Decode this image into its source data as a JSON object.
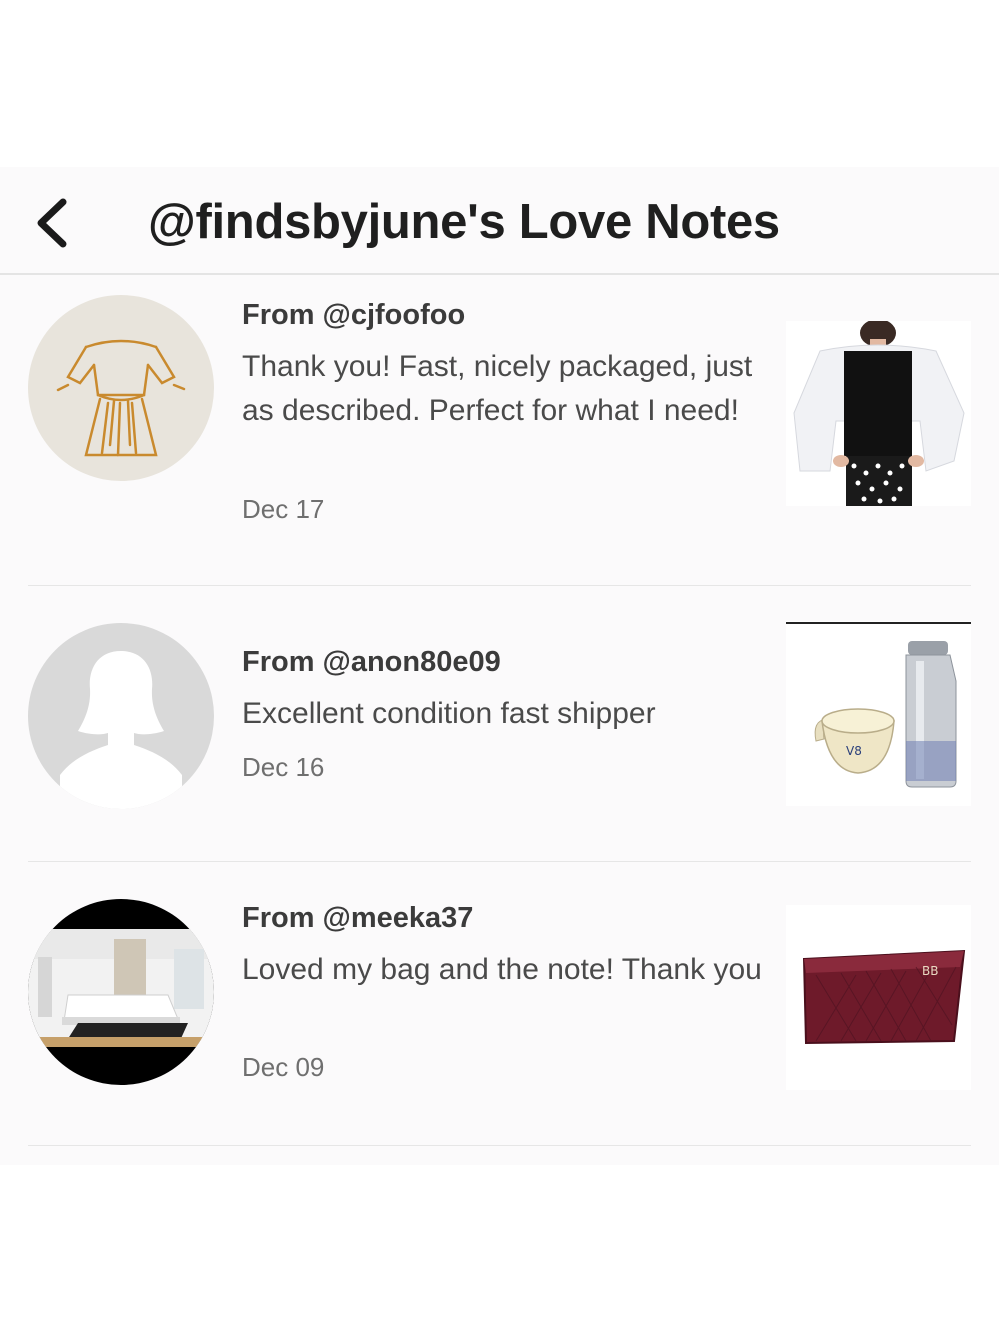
{
  "header": {
    "title": "@findsbyjune's Love Notes",
    "back_icon": "chevron-left-icon"
  },
  "notes": [
    {
      "from": "From @cjfoofoo",
      "message": "Thank you! Fast, nicely packaged, just as described. Perfect for what I need!",
      "date": "Dec 17",
      "avatar": "dress-sketch-avatar",
      "product": "white-shrug-top-photo"
    },
    {
      "from": "From @anon80e09",
      "message": "Excellent condition fast shipper",
      "date": "Dec 16",
      "avatar": "default-person-avatar",
      "product": "mug-and-bottle-photo"
    },
    {
      "from": "From @meeka37",
      "message": "Loved my bag and the note! Thank you",
      "date": "Dec 09",
      "avatar": "bedroom-photo-avatar",
      "product": "burgundy-clutch-photo"
    }
  ],
  "colors": {
    "background": "#fbfafb",
    "title": "#1f1f1f",
    "text": "#4a4a4a",
    "divider": "#e6e6e6"
  }
}
